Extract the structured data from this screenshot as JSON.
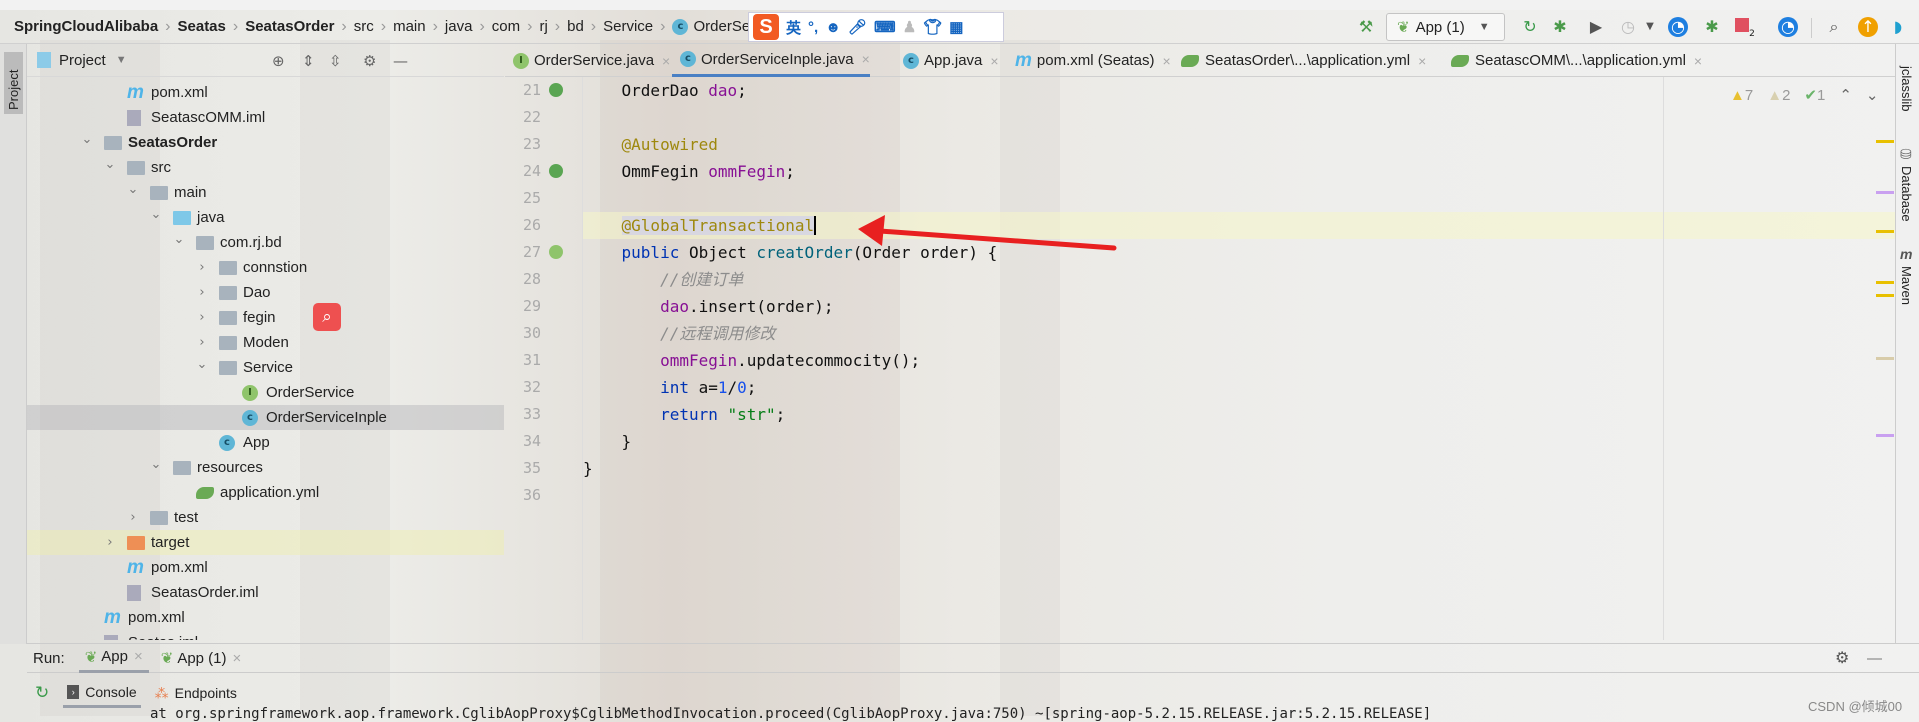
{
  "breadcrumb": [
    {
      "label": "SpringCloudAlibaba",
      "bold": true
    },
    {
      "label": "Seatas",
      "bold": true
    },
    {
      "label": "SeatasOrder",
      "bold": true
    },
    {
      "label": "src"
    },
    {
      "label": "main"
    },
    {
      "label": "java"
    },
    {
      "label": "com"
    },
    {
      "label": "rj"
    },
    {
      "label": "bd"
    },
    {
      "label": "Service"
    },
    {
      "label": "OrderService",
      "icon": "class-icon"
    }
  ],
  "ime": {
    "logo": "S",
    "lang": "英",
    "punct": "°,"
  },
  "toolbar": {
    "run_config": "App (1)",
    "icons": [
      "build-hammer-icon",
      "rerun-icon",
      "debug-icon",
      "run-with-coverage-icon",
      "profile-icon",
      "dropdown-icon",
      "speedometer-icon",
      "debug-stop-icon",
      "stop-icon",
      "speedometer-plugin-icon",
      "search-icon",
      "update-icon",
      "ide-logo-icon"
    ],
    "stop_badge": "2"
  },
  "left_strip": {
    "label": "Project"
  },
  "project_panel": {
    "title": "Project"
  },
  "tree": [
    {
      "label": "pom.xml",
      "level": 2,
      "type": "maven"
    },
    {
      "label": "SeatascOMM.iml",
      "level": 2,
      "type": "iml"
    },
    {
      "label": "SeatasOrder",
      "level": 1,
      "type": "module",
      "expanded": true,
      "bold": true
    },
    {
      "label": "src",
      "level": 2,
      "type": "folder",
      "expanded": true
    },
    {
      "label": "main",
      "level": 3,
      "type": "folder",
      "expanded": true
    },
    {
      "label": "java",
      "level": 4,
      "type": "source-folder",
      "expanded": true
    },
    {
      "label": "com.rj.bd",
      "level": 5,
      "type": "package",
      "expanded": true
    },
    {
      "label": "connstion",
      "level": 6,
      "type": "package",
      "expanded": false
    },
    {
      "label": "Dao",
      "level": 6,
      "type": "package",
      "expanded": false
    },
    {
      "label": "fegin",
      "level": 6,
      "type": "package",
      "expanded": false
    },
    {
      "label": "Moden",
      "level": 6,
      "type": "package",
      "expanded": false
    },
    {
      "label": "Service",
      "level": 6,
      "type": "package",
      "expanded": true
    },
    {
      "label": "OrderService",
      "level": 7,
      "type": "interface"
    },
    {
      "label": "OrderServiceInple",
      "level": 7,
      "type": "class",
      "selected": true
    },
    {
      "label": "App",
      "level": 6,
      "type": "spring-app"
    },
    {
      "label": "resources",
      "level": 4,
      "type": "resources",
      "expanded": true
    },
    {
      "label": "application.yml",
      "level": 5,
      "type": "yml"
    },
    {
      "label": "test",
      "level": 3,
      "type": "folder",
      "expanded": false
    },
    {
      "label": "target",
      "level": 2,
      "type": "excluded-folder",
      "expanded": false,
      "highlight": true
    },
    {
      "label": "pom.xml",
      "level": 2,
      "type": "maven"
    },
    {
      "label": "SeatasOrder.iml",
      "level": 2,
      "type": "iml"
    },
    {
      "label": "pom.xml",
      "level": 1,
      "type": "maven"
    },
    {
      "label": "Seatas.iml",
      "level": 1,
      "type": "iml"
    }
  ],
  "tabs": [
    {
      "label": "OrderService.java",
      "icon": "interface-icon"
    },
    {
      "label": "OrderServiceInple.java",
      "icon": "class-icon",
      "active": true
    },
    {
      "label": "App.java",
      "icon": "spring-app-icon"
    },
    {
      "label": "pom.xml (Seatas)",
      "icon": "maven-icon"
    },
    {
      "label": "SeatasOrder\\...\\application.yml",
      "icon": "yml-icon"
    },
    {
      "label": "SeatascOMM\\...\\application.yml",
      "icon": "yml-icon"
    }
  ],
  "inspections": {
    "warnings": "7",
    "weak_warnings": "2",
    "typos": "1"
  },
  "code": [
    {
      "n": "21",
      "gutter": "bean-icon",
      "tokens": [
        [
          "    OrderDao ",
          ""
        ],
        [
          "dao",
          "fld"
        ],
        [
          ";",
          ""
        ]
      ]
    },
    {
      "n": "22",
      "tokens": []
    },
    {
      "n": "23",
      "tokens": [
        [
          "    ",
          ""
        ],
        [
          "@Autowired",
          "ann"
        ]
      ]
    },
    {
      "n": "24",
      "gutter": "bean-icon",
      "tokens": [
        [
          "    OmmFegin ",
          ""
        ],
        [
          "ommFegin",
          "fld"
        ],
        [
          ";",
          ""
        ]
      ]
    },
    {
      "n": "25",
      "tokens": []
    },
    {
      "n": "26",
      "caret": true,
      "tokens": [
        [
          "    ",
          ""
        ],
        [
          "@GlobalTransactional",
          "ann selbg"
        ]
      ]
    },
    {
      "n": "27",
      "gutter": "implements-icon",
      "tokens": [
        [
          "    ",
          ""
        ],
        [
          "public",
          "kw"
        ],
        [
          " Object ",
          ""
        ],
        [
          "creatOrder",
          "fn"
        ],
        [
          "(Order order) {",
          ""
        ]
      ]
    },
    {
      "n": "28",
      "tokens": [
        [
          "        ",
          ""
        ],
        [
          "//创建订单",
          "cm"
        ]
      ]
    },
    {
      "n": "29",
      "tokens": [
        [
          "        ",
          ""
        ],
        [
          "dao",
          "fld"
        ],
        [
          ".insert(order);",
          ""
        ]
      ]
    },
    {
      "n": "30",
      "tokens": [
        [
          "        ",
          ""
        ],
        [
          "//远程调用修改",
          "cm"
        ]
      ]
    },
    {
      "n": "31",
      "tokens": [
        [
          "        ",
          ""
        ],
        [
          "ommFegin",
          "fld"
        ],
        [
          ".updatecommocity();",
          ""
        ]
      ]
    },
    {
      "n": "32",
      "tokens": [
        [
          "        ",
          ""
        ],
        [
          "int",
          "kw"
        ],
        [
          " a=",
          ""
        ],
        [
          "1",
          "num"
        ],
        [
          "/",
          ""
        ],
        [
          "0",
          "num"
        ],
        [
          ";",
          ""
        ]
      ]
    },
    {
      "n": "33",
      "tokens": [
        [
          "        ",
          ""
        ],
        [
          "return",
          "kw"
        ],
        [
          " ",
          ""
        ],
        [
          "\"str\"",
          "str"
        ],
        [
          ";",
          ""
        ]
      ]
    },
    {
      "n": "34",
      "tokens": [
        [
          "    }",
          ""
        ]
      ]
    },
    {
      "n": "35",
      "tokens": [
        [
          "}",
          ""
        ]
      ]
    },
    {
      "n": "36",
      "tokens": []
    }
  ],
  "right_strip": [
    "jclasslib",
    "Database",
    "Maven"
  ],
  "run": {
    "label": "Run:",
    "tabs": [
      "App",
      "App (1)"
    ]
  },
  "console": {
    "tabs": [
      "Console",
      "Endpoints"
    ],
    "line": "at org.springframework.aop.framework.CglibAopProxy$CglibMethodInvocation.proceed(CglibAopProxy.java:750) ~[spring-aop-5.2.15.RELEASE.jar:5.2.15.RELEASE]"
  },
  "watermark": "CSDN @倾城00",
  "colors": {
    "accent": "#4a80c4",
    "annotation": "#9e880d",
    "keyword": "#0033b3",
    "field": "#871094",
    "arrow": "#e82020"
  }
}
